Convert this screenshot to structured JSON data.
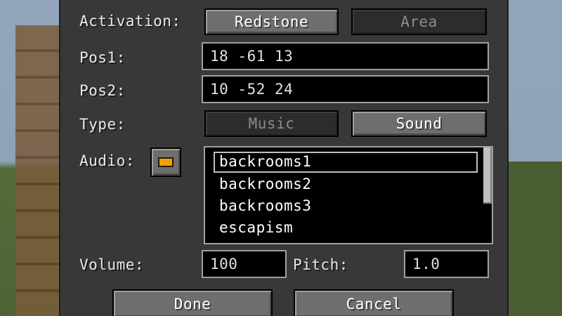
{
  "title": "",
  "activation": {
    "label": "Activation:",
    "options": [
      "Redstone",
      "Area"
    ],
    "selected": "Redstone"
  },
  "pos1": {
    "label": "Pos1:",
    "value": "18 -61 13"
  },
  "pos2": {
    "label": "Pos2:",
    "value": "10 -52 24"
  },
  "type": {
    "label": "Type:",
    "options": [
      "Music",
      "Sound"
    ],
    "selected": "Sound"
  },
  "audio": {
    "label": "Audio:",
    "button_color": "#f0a000",
    "items": [
      "backrooms1",
      "backrooms2",
      "backrooms3",
      "escapism"
    ],
    "selected": "backrooms1"
  },
  "volume": {
    "label": "Volume:",
    "value": "100"
  },
  "pitch": {
    "label": "Pitch:",
    "value": "1.0"
  },
  "buttons": {
    "done": "Done",
    "cancel": "Cancel"
  }
}
